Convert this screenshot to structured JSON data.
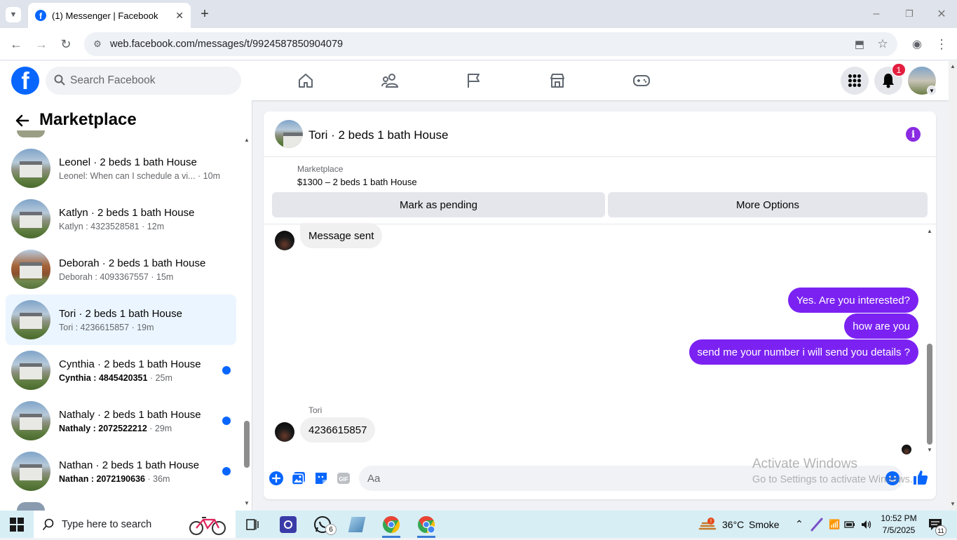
{
  "browser": {
    "tab_title": "(1) Messenger | Facebook",
    "url": "web.facebook.com/messages/t/9924587850904079"
  },
  "header": {
    "search_placeholder": "Search Facebook",
    "notification_count": "1"
  },
  "sidebar": {
    "title": "Marketplace",
    "conversations": [
      {
        "name": "Leonel · 2 beds 1 bath House",
        "preview": "Leonel: When can I schedule a vi...",
        "time": "· 10m",
        "unread": false,
        "selected": false
      },
      {
        "name": "Katlyn · 2 beds 1 bath House",
        "preview": "Katlyn : 4323528581",
        "time": "· 12m",
        "unread": false,
        "selected": false
      },
      {
        "name": "Deborah · 2 beds 1 bath House",
        "preview": "Deborah : 4093367557",
        "time": "· 15m",
        "unread": false,
        "selected": false
      },
      {
        "name": "Tori · 2 beds 1 bath House",
        "preview": "Tori : 4236615857",
        "time": "· 19m",
        "unread": false,
        "selected": true
      },
      {
        "name": "Cynthia · 2 beds 1 bath House",
        "preview": "Cynthia : 4845420351",
        "time": "· 25m",
        "unread": true,
        "selected": false
      },
      {
        "name": "Nathaly · 2 beds 1 bath House",
        "preview": "Nathaly : 2072522212",
        "time": "· 29m",
        "unread": true,
        "selected": false
      },
      {
        "name": "Nathan · 2 beds 1 bath House",
        "preview": "Nathan : 2072190636",
        "time": "· 36m",
        "unread": true,
        "selected": false
      }
    ]
  },
  "chat": {
    "title": "Tori · 2 beds 1 bath House",
    "marketplace_label": "Marketplace",
    "listing": "$1300 – 2 beds 1 bath House",
    "mark_pending": "Mark as pending",
    "more_options": "More Options",
    "messages": [
      {
        "text": "Message sent",
        "from": "them"
      },
      {
        "text": "Yes. Are you interested?",
        "from": "me"
      },
      {
        "text": "how are you",
        "from": "me"
      },
      {
        "text": "send me your number i will send you details ?",
        "from": "me"
      },
      {
        "text": "4236615857",
        "from": "them",
        "sender": "Tori"
      }
    ],
    "composer_placeholder": "Aa"
  },
  "watermark": {
    "line1": "Activate Windows",
    "line2": "Go to Settings to activate Windows."
  },
  "taskbar": {
    "search_placeholder": "Type here to search",
    "whatsapp_badge": "6",
    "weather_temp": "36°C",
    "weather_desc": "Smoke",
    "time": "10:52 PM",
    "date": "7/5/2025",
    "notif_count": "11"
  },
  "colors": {
    "fb_blue": "#0866ff",
    "messenger_purple": "#7b22f2",
    "selected_bg": "#ebf5ff"
  }
}
